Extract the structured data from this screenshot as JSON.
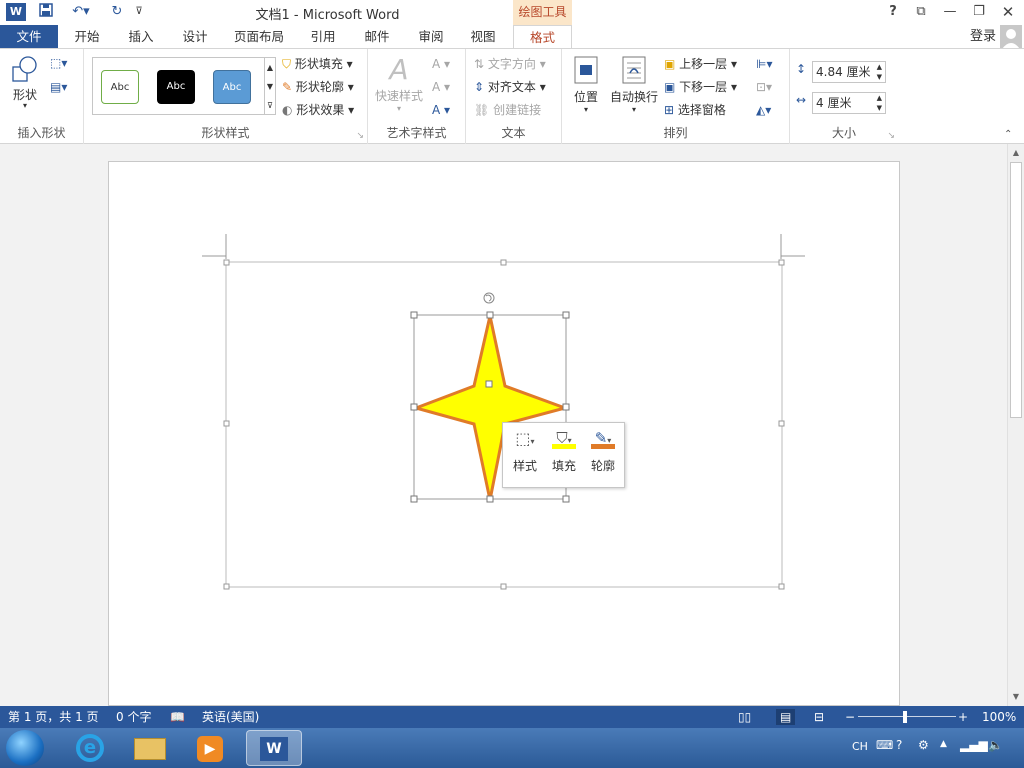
{
  "app": {
    "title": "文档1 - Microsoft Word",
    "context_tab": "绘图工具",
    "login": "登录"
  },
  "tabs": [
    {
      "label": "文件"
    },
    {
      "label": "开始"
    },
    {
      "label": "插入"
    },
    {
      "label": "设计"
    },
    {
      "label": "页面布局"
    },
    {
      "label": "引用"
    },
    {
      "label": "邮件"
    },
    {
      "label": "审阅"
    },
    {
      "label": "视图"
    },
    {
      "label": "格式"
    }
  ],
  "ribbon": {
    "insert_shapes": {
      "shapes_label": "形状",
      "group_label": "插入形状"
    },
    "shape_styles": {
      "style_samples": [
        "Abc",
        "Abc",
        "Abc"
      ],
      "fill_label": "形状填充",
      "outline_label": "形状轮廓",
      "effects_label": "形状效果",
      "group_label": "形状样式"
    },
    "wordart": {
      "quick_styles_label": "快速样式",
      "group_label": "艺术字样式"
    },
    "text": {
      "direction_label": "文字方向",
      "align_label": "对齐文本",
      "link_label": "创建链接",
      "group_label": "文本"
    },
    "arrange": {
      "position_label": "位置",
      "wrap_label": "自动换行",
      "forward_label": "上移一层",
      "backward_label": "下移一层",
      "selection_pane_label": "选择窗格",
      "group_label": "排列"
    },
    "size": {
      "height_value": "4.84 厘米",
      "width_value": "4 厘米",
      "group_label": "大小"
    }
  },
  "mini_toolbar": {
    "style_label": "样式",
    "fill_label": "填充",
    "outline_label": "轮廓"
  },
  "status": {
    "page_info": "第 1 页，共 1 页",
    "word_count": "0 个字",
    "language": "英语(美国)",
    "zoom": "100%"
  },
  "taskbar": {
    "ime": "CH"
  },
  "colors": {
    "word_blue": "#2b579a",
    "context_orange": "#b7472a",
    "star_fill": "#ffff00",
    "star_outline": "#e07b28"
  }
}
